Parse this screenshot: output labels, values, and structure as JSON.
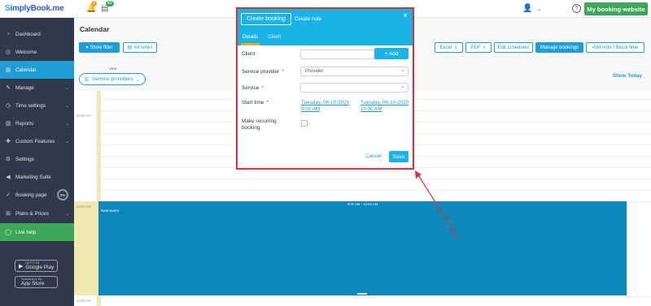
{
  "brand": {
    "logo_prefix": "S",
    "logo_rest": "implyBook.me"
  },
  "topbar": {
    "notifications_count": "1",
    "tasks_count": "40",
    "my_booking_website": "My booking website"
  },
  "sidebar": {
    "items": [
      {
        "label": "Dashboard"
      },
      {
        "label": "Welcome"
      },
      {
        "label": "Calendar"
      },
      {
        "label": "Manage"
      },
      {
        "label": "Time settings"
      },
      {
        "label": "Reports"
      },
      {
        "label": "Custom Features"
      },
      {
        "label": "Settings"
      },
      {
        "label": "Marketing Suite"
      },
      {
        "label": "Booking page"
      },
      {
        "label": "Plans & Prices"
      },
      {
        "label": "Live help"
      }
    ],
    "booking_page_progress": "0%",
    "google_play": {
      "small": "GET IT ON",
      "name": "Google Play"
    },
    "app_store": {
      "small": "Download on the",
      "name": "App Store"
    }
  },
  "main": {
    "title": "Calendar",
    "show_filter": "Show filter",
    "all_notes": "All notes",
    "view_label": "View",
    "service_providers": "Service providers",
    "show_today": "Show Today",
    "toolbar": {
      "excel": "Excel",
      "pdf": "PDF",
      "edit_schedules": "Edit schedules",
      "manage_bookings": "Manage bookings",
      "add_note": "Add note / Block time"
    },
    "times": [
      "08:00 AM",
      "09:00 AM",
      "10:00 AM"
    ],
    "event": {
      "time": "9:00 AM - 10:00 AM",
      "title": "New event"
    }
  },
  "modal": {
    "tab_create_booking": "Create booking",
    "tab_create_note": "Create note",
    "close": "×",
    "subtab_details": "Details",
    "subtab_client": "Client",
    "client_label": "Client",
    "add_label": "+ Add",
    "service_provider_label": "Service provider",
    "service_provider_value": "Provider",
    "service_label": "Service",
    "start_time_label": "Start time",
    "start_date": "Tuesday, 06-10-2020",
    "start_time": "9:00 AM",
    "end_date": "Tuesday, 06-10-2020",
    "end_time": "10:00 AM",
    "recurring_label_1": "Make recurring",
    "recurring_label_2": "booking",
    "required_mark": "*",
    "cancel": "Cancel",
    "save": "Save"
  },
  "colors": {
    "accent": "#1ab3e6",
    "sidebar_bg": "#2f3949",
    "active": "#1f9dd4",
    "green": "#3aa856",
    "highlight": "#e0302f",
    "event": "#0e87bb"
  },
  "icons": [
    "bell-icon",
    "clipboard-icon",
    "user-icon",
    "help-icon",
    "search-icon",
    "close-icon",
    "chevron-down-icon",
    "filter-icon",
    "notes-icon"
  ]
}
